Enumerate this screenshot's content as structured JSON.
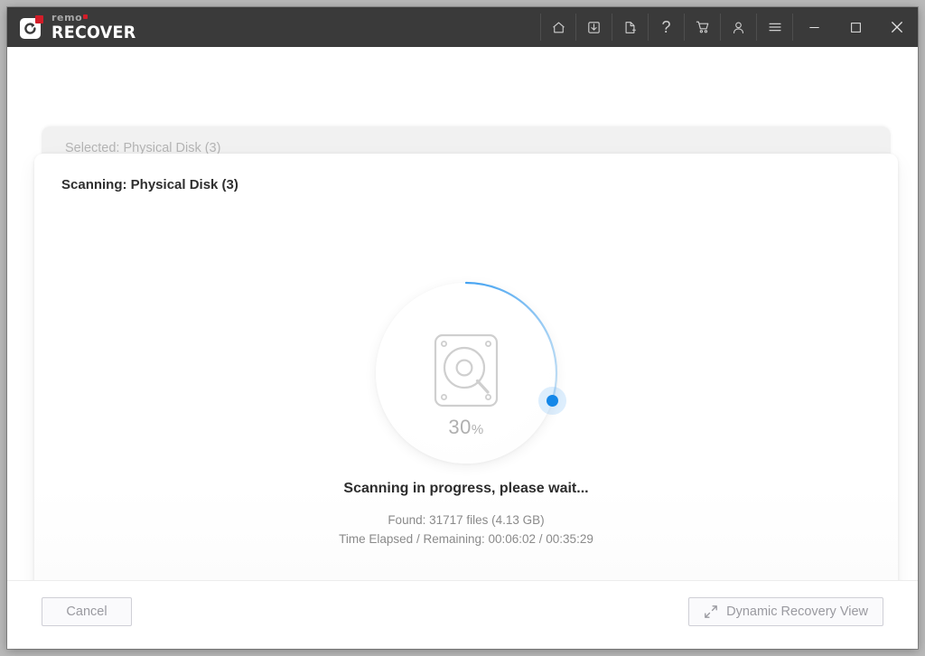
{
  "window": {
    "brand_small": "rem",
    "brand_small_tail": "o",
    "brand_big": "RECOVER",
    "logo_icon": "remo-refresh-logo-icon"
  },
  "titlebar": {
    "tools": [
      {
        "name": "home-icon",
        "label": "Home"
      },
      {
        "name": "download-icon",
        "label": "Save Recovery Session"
      },
      {
        "name": "new-file-icon",
        "label": "New Scan"
      },
      {
        "name": "help-icon",
        "label": "Help"
      },
      {
        "name": "cart-icon",
        "label": "Buy Now"
      },
      {
        "name": "user-icon",
        "label": "Account"
      },
      {
        "name": "menu-icon",
        "label": "Menu"
      }
    ],
    "controls": [
      {
        "name": "minimize-button",
        "glyph": "—"
      },
      {
        "name": "maximize-button",
        "glyph": "□"
      },
      {
        "name": "close-button",
        "glyph": "✕"
      }
    ]
  },
  "cards": {
    "selected_label": "Selected: Physical Disk (3)",
    "scanning_label": "Scanning: Physical Disk (3)"
  },
  "progress": {
    "percent": 30,
    "percent_value": "30",
    "percent_sign": "%",
    "arc_color": "#2b96f0",
    "track_color": "#edf1f4",
    "dot_color": "#1487e8",
    "disk_icon": "hard-disk-search-icon"
  },
  "status": {
    "title": "Scanning in progress, please wait...",
    "found": "Found: 31717 files (4.13 GB)",
    "time": "Time Elapsed / Remaining:  00:06:02 / 00:35:29"
  },
  "footer": {
    "cancel_label": "Cancel",
    "dynamic_view_label": "Dynamic Recovery View",
    "dynamic_view_icon": "expand-diagonal-icon"
  }
}
